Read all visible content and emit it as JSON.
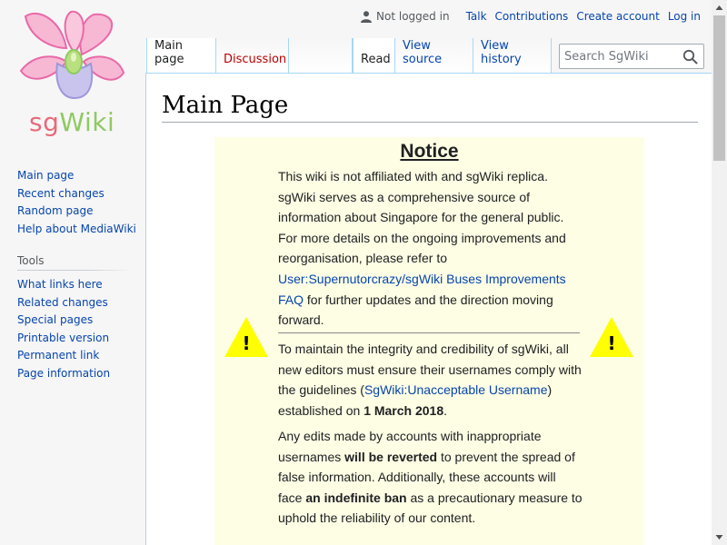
{
  "logo": {
    "text_sg": "sg",
    "text_wiki": "Wiki"
  },
  "personal": {
    "status": "Not logged in",
    "items": [
      "Talk",
      "Contributions",
      "Create account",
      "Log in"
    ]
  },
  "tabs": {
    "main": "Main page",
    "discussion": "Discussion",
    "read": "Read",
    "view_source": "View source",
    "view_history": "View history"
  },
  "search": {
    "placeholder": "Search SgWiki"
  },
  "sidebar": {
    "navigation": [
      "Main page",
      "Recent changes",
      "Random page",
      "Help about MediaWiki"
    ],
    "tools_heading": "Tools",
    "tools": [
      "What links here",
      "Related changes",
      "Special pages",
      "Printable version",
      "Permanent link",
      "Page information"
    ]
  },
  "page": {
    "title": "Main Page",
    "notice": {
      "title": "Notice",
      "p1_a": "This wiki is not affiliated with and sgWiki replica. sgWiki serves as a comprehensive source of information about Singapore for the general public. For more details on the ongoing improvements and reorganisation, please refer to ",
      "p1_link": "User:Supernutorcrazy/sgWiki Buses Improvements FAQ",
      "p1_b": " for further updates and the direction moving forward.",
      "p2_a": "To maintain the integrity and credibility of sgWiki, all new editors must ensure their usernames comply with the guidelines (",
      "p2_link": "SgWiki:Unacceptable Username",
      "p2_b": ") established on ",
      "p2_bold": "1 March 2018",
      "p2_c": ".",
      "p3_a": "Any edits made by accounts with inappropriate usernames ",
      "p3_bold1": "will be reverted",
      "p3_b": " to prevent the spread of false information. Additionally, these accounts will face ",
      "p3_bold2": "an indefinite ban",
      "p3_c": " as a precautionary measure to uphold the reliability of our content.",
      "warning_symbol": "!"
    }
  },
  "colors": {
    "link": "#0645ad",
    "redlink": "#ba0000",
    "notice_bg": "#fefee5",
    "warning_yellow": "#ffff00"
  }
}
